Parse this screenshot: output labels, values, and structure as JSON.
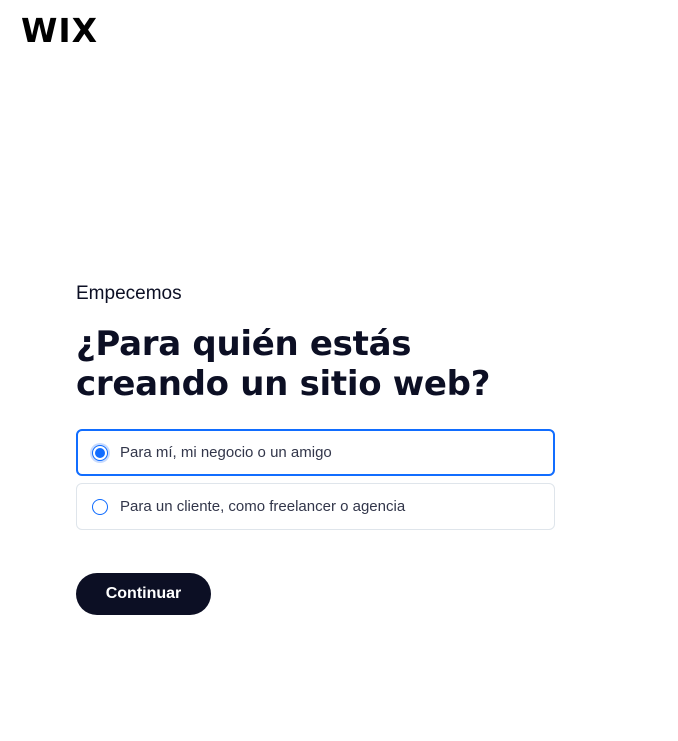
{
  "header": {
    "logo_text": "WIX"
  },
  "main": {
    "eyebrow": "Empecemos",
    "title": "¿Para quién estás creando un sitio web?",
    "options": [
      {
        "label": "Para mí, mi negocio o un amigo",
        "selected": true
      },
      {
        "label": "Para un cliente, como freelancer o agencia",
        "selected": false
      }
    ],
    "continue_label": "Continuar"
  },
  "colors": {
    "accent": "#116dff",
    "text_dark": "#0c0f24",
    "option_text": "#32364a",
    "option_border": "#dfe5eb"
  }
}
